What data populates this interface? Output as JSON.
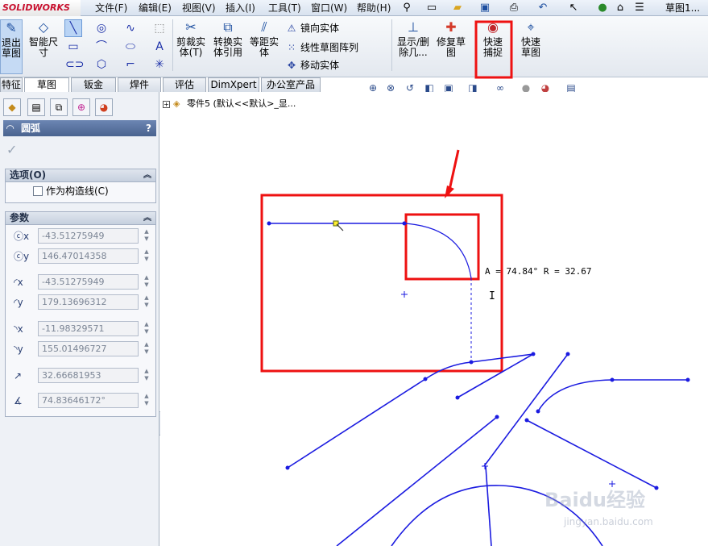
{
  "app": {
    "logo": "SOLIDWORKS",
    "menu": [
      "文件(F)",
      "编辑(E)",
      "视图(V)",
      "插入(I)",
      "工具(T)",
      "窗口(W)",
      "帮助(H)"
    ],
    "document_title": "草图1..."
  },
  "toolbar": {
    "exit_sketch": "退出草图",
    "smart_dim": "智能尺寸",
    "trim": "剪裁实体(T)",
    "convert": "转换实体引用",
    "offset": "等距实体",
    "mirror": "镜向实体",
    "linear_pattern": "线性草图阵列",
    "move": "移动实体",
    "show_delete": "显示/删除几...",
    "repair": "修复草图",
    "quick_snap": "快速捕捉",
    "rapid_sketch": "快速草图"
  },
  "tabs": [
    "特征",
    "草图",
    "钣金",
    "焊件",
    "评估",
    "DimXpert",
    "办公室产品"
  ],
  "active_tab": 1,
  "property_manager": {
    "title": "圆弧",
    "help": "?",
    "options_title": "选项(O)",
    "construction_label": "作为构造线(C)",
    "params_title": "参数",
    "params": [
      {
        "icon": "center-x-icon",
        "value": "-43.51275949"
      },
      {
        "icon": "center-y-icon",
        "value": "146.47014358"
      },
      {
        "icon": "start-x-icon",
        "value": "-43.51275949"
      },
      {
        "icon": "start-y-icon",
        "value": "179.13696312"
      },
      {
        "icon": "end-x-icon",
        "value": "-11.98329571"
      },
      {
        "icon": "end-y-icon",
        "value": "155.01496727"
      },
      {
        "icon": "radius-icon",
        "value": "32.66681953"
      },
      {
        "icon": "angle-icon",
        "value": "74.83646172°"
      }
    ]
  },
  "tree": {
    "node": "零件5 (默认<<默认>_显..."
  },
  "graphics": {
    "dimension_text": "A = 74.84°  R = 32.67",
    "cursor": "I"
  },
  "watermark": {
    "main": "Baidu经验",
    "sub": "jingyan.baidu.com"
  },
  "colors": {
    "sketch_blue": "#1b1be0",
    "highlight_red": "#ee1111"
  }
}
